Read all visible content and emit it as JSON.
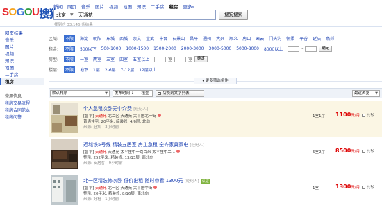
{
  "logo": {
    "letters": [
      "S",
      "O",
      "G",
      "O",
      "U",
      "搜",
      "狗"
    ],
    "colors": [
      "#e6262b",
      "#f6a31b",
      "#3b73d8",
      "#2a9b3c",
      "#e6262b",
      "#1b4fb4",
      "#1b4fb4"
    ]
  },
  "navbar": [
    "新闻",
    "网页",
    "音乐",
    "图片",
    "视频",
    "地图",
    "知识",
    "二手房",
    "租房",
    "更多»"
  ],
  "search": {
    "city": "北京",
    "query": "天通苑",
    "button": "搜狗搜索",
    "results": "找到约 33,146 条结果"
  },
  "sidebar": {
    "items": [
      "网页结果",
      "音乐",
      "图片",
      "视频",
      "知识",
      "地图",
      "二手房",
      "租房"
    ],
    "section_title": "常用信息",
    "links": [
      "租房交易流程",
      "租房合同范本",
      "租房问答"
    ]
  },
  "filters": {
    "region": {
      "label": "区域:",
      "options": [
        "不限",
        "海淀",
        "朝阳",
        "东城",
        "西城",
        "崇文",
        "宣武",
        "丰台",
        "石景山",
        "昌平",
        "通州",
        "大兴",
        "顺义",
        "房山",
        "密云",
        "门头沟",
        "怀柔",
        "平谷",
        "延庆",
        "燕郊"
      ]
    },
    "rent": {
      "label": "租金:",
      "options": [
        "不限",
        "500以下",
        "500-1000",
        "1000-1500",
        "1500-2000",
        "2000-3000",
        "3000-5000",
        "5000-8000",
        "8000以上"
      ],
      "button": "确定"
    },
    "rooms": {
      "label": "房型:",
      "options": [
        "不限",
        "一室",
        "两室",
        "三室",
        "四室",
        "五室以上"
      ],
      "unit": "室",
      "button": "确定"
    },
    "floor": {
      "label": "楼层:",
      "options": [
        "不限",
        "地下",
        "1层",
        "2-6层",
        "7-12层",
        "12层以上"
      ]
    },
    "more": "更多筛选条件"
  },
  "sortbar": {
    "default_sort": "默认排序",
    "pub_time": "发布时间",
    "rent": "租金",
    "toggle": "切换到文字列表",
    "recent": "最近浏览"
  },
  "listings": [
    {
      "title": "个人急租次卧无中介费",
      "agent": "[经纪人]",
      "addr_prefix": "[昌平]",
      "community": "天通苑",
      "addr_rest": "北二区 天通苑 太平庄北一街",
      "detail": "普通住宅, 20平米, 简装修, 4/6层, 北向",
      "source": "来源: 赶集 - 3小时前",
      "rooms": "1室1厅",
      "price": "1100",
      "unit": "元/月",
      "compare": "比较"
    },
    {
      "title": "近城铁5号线 精装五居室 房主急租 全齐家具家电",
      "agent": "[经纪人]",
      "addr_prefix": "[昌平]",
      "community": "天通苑",
      "addr_rest": "天通苑 太平庄中一路百米 太平庄中二...",
      "detail": "整租, 252平米, 精装修, 13/13层, 南北向",
      "source": "来源: 安居客 - 9小时前",
      "rooms": "5室2厅",
      "price": "8500",
      "unit": "元/月",
      "compare": "比较"
    },
    {
      "title": "北一区精装修次卧 低价出租 随时带看 1300元",
      "agent": "[经纪人]",
      "tag": "认证",
      "addr_prefix": "[昌平]",
      "community": "天通苑",
      "addr_rest": "北一区 天通苑 太平庄中街",
      "detail": "整租, 20平米, 精装修, 8/16层, 南北向",
      "source": "来源: 好租 - 1小时前",
      "rooms": "1室",
      "price": "1300",
      "unit": "元/月",
      "compare": "比较"
    }
  ]
}
